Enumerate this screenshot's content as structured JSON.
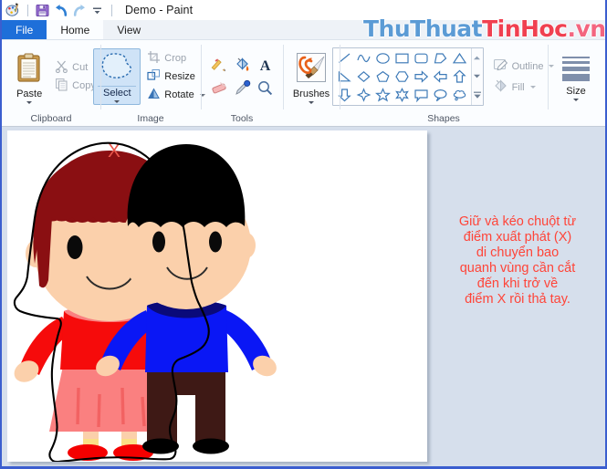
{
  "window": {
    "title": "Demo - Paint",
    "quick_access": [
      {
        "name": "paint-app-icon",
        "label": "Paint"
      },
      {
        "name": "save-icon",
        "label": "Save"
      },
      {
        "name": "undo-icon",
        "label": "Undo"
      },
      {
        "name": "redo-icon",
        "label": "Redo"
      },
      {
        "name": "customize-qat-icon",
        "label": "Customize Quick Access Toolbar"
      }
    ]
  },
  "tabs": [
    {
      "label": "File",
      "id": "file",
      "active": false
    },
    {
      "label": "Home",
      "id": "home",
      "active": true
    },
    {
      "label": "View",
      "id": "view",
      "active": false
    }
  ],
  "ribbon": {
    "clipboard": {
      "label": "Clipboard",
      "paste": "Paste",
      "cut": "Cut",
      "copy": "Copy"
    },
    "image": {
      "label": "Image",
      "select": "Select",
      "crop": "Crop",
      "resize": "Resize",
      "rotate": "Rotate"
    },
    "tools": {
      "label": "Tools",
      "items": [
        {
          "name": "pencil-icon",
          "label": "Pencil"
        },
        {
          "name": "fill-bucket-icon",
          "label": "Fill with color"
        },
        {
          "name": "text-icon",
          "label": "Text"
        },
        {
          "name": "eraser-icon",
          "label": "Eraser"
        },
        {
          "name": "color-picker-icon",
          "label": "Color picker"
        },
        {
          "name": "magnifier-icon",
          "label": "Magnifier"
        }
      ]
    },
    "brushes": {
      "label": "Brushes"
    },
    "shapes": {
      "label": "Shapes",
      "items": [
        "line",
        "curve",
        "oval",
        "rectangle",
        "rounded-rectangle",
        "polygon",
        "triangle",
        "right-triangle",
        "diamond",
        "pentagon",
        "hexagon",
        "right-arrow",
        "left-arrow",
        "up-arrow",
        "down-arrow",
        "four-point-star",
        "five-point-star",
        "six-point-star",
        "rounded-callout",
        "oval-callout",
        "cloud-callout"
      ],
      "outline": "Outline",
      "fill": "Fill"
    },
    "size": {
      "label": "Size"
    }
  },
  "watermark": {
    "part1": "ThuThuat",
    "part2": "TinHoc",
    "part3": ".vn",
    "color1": "#5b9bd5",
    "color2": "#f04050",
    "color3": "#f3657f"
  },
  "canvas": {
    "selection_start_marker": "X",
    "marker_color": "#e8554a",
    "girl": {
      "hair_color": "#8a0f12",
      "skin_color": "#fbd0ab",
      "top_color": "#f60b0b",
      "collar_color": "#fa8080",
      "skirt_color": "#fa8080",
      "sock_color": "#fbe086",
      "shoe_color": "#f40000"
    },
    "boy": {
      "hair_color": "#000000",
      "skin_color": "#fbd0ab",
      "sweater_color": "#0a17f5",
      "collar_color": "#0a0a7a",
      "pants_color": "#3e1915",
      "shoe_color": "#000000"
    },
    "selection_outline_color": "#000000"
  },
  "instructions": {
    "color": "#ff4438",
    "lines": [
      "Giữ và kéo chuột từ",
      "điểm xuất phát (X)",
      "di chuyển bao",
      "quanh vùng cần cắt",
      "đến khi trở về",
      "điểm X rồi thả tay."
    ]
  }
}
